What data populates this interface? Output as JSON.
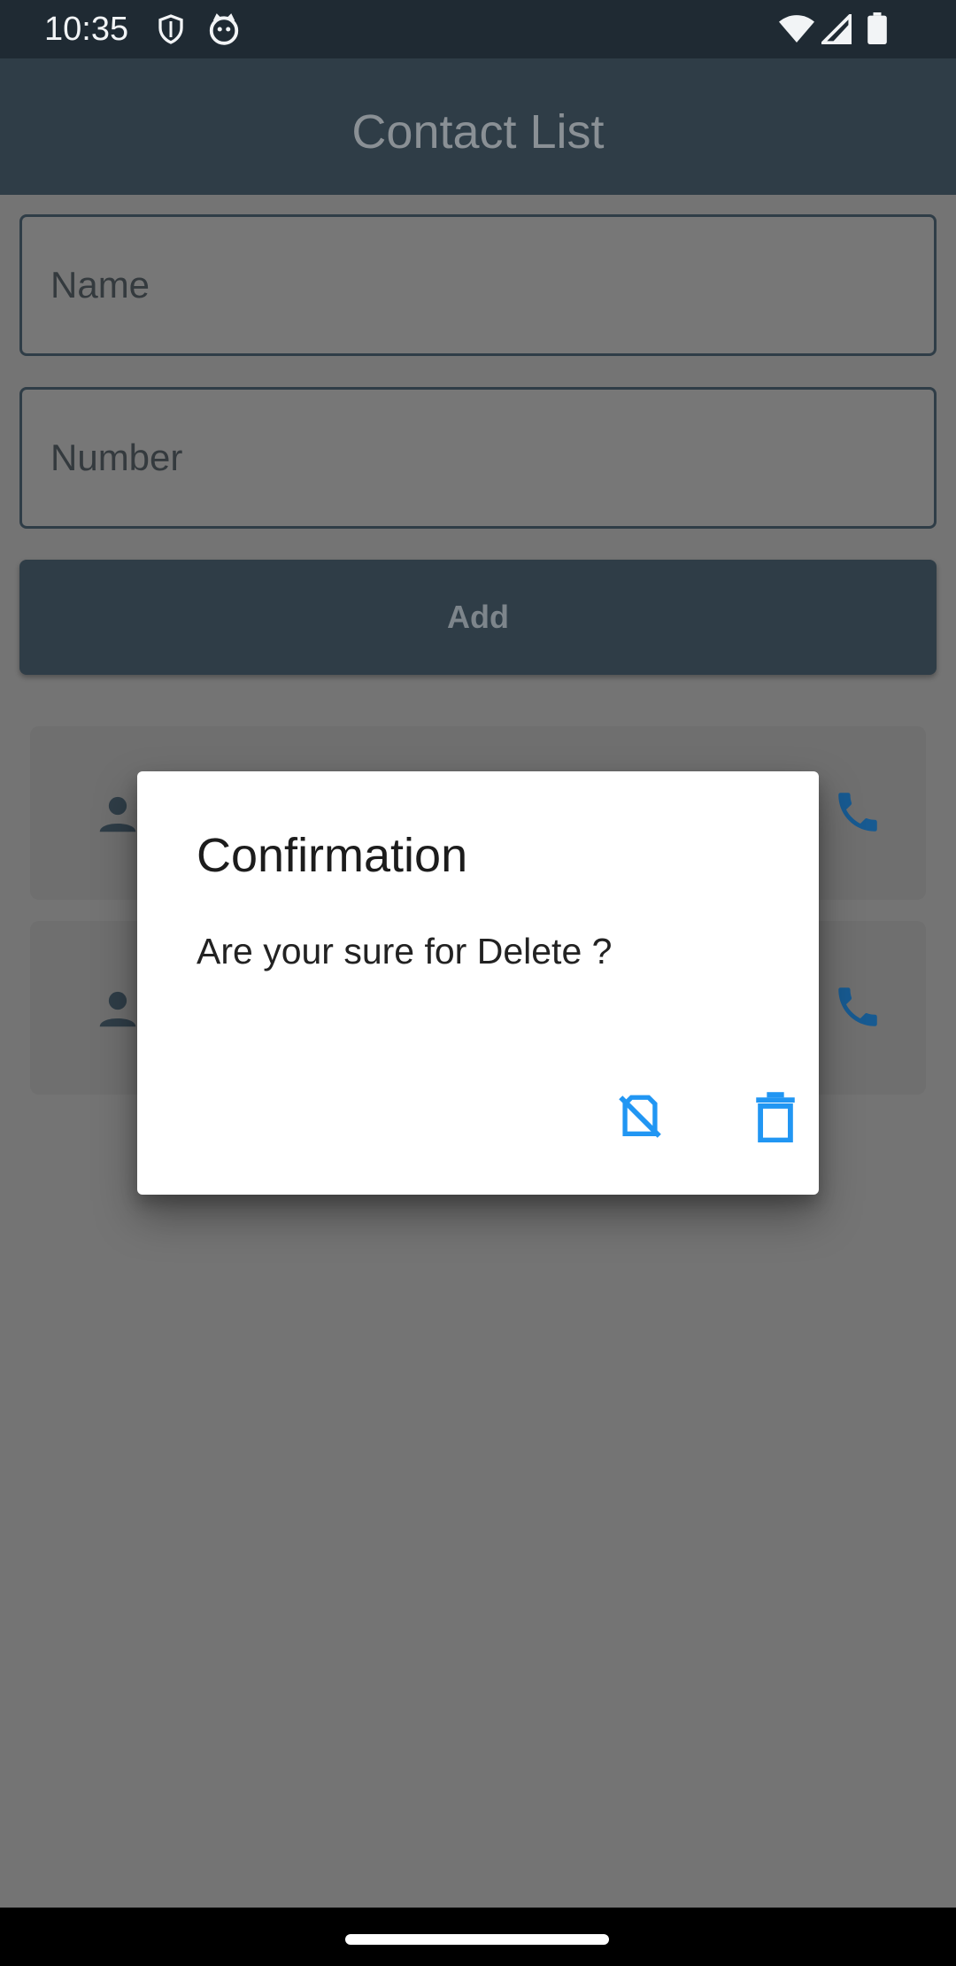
{
  "status_bar": {
    "time": "10:35",
    "icons": [
      "shield-icon",
      "cat-icon",
      "wifi-icon",
      "signal-icon",
      "battery-icon"
    ]
  },
  "app_bar": {
    "title": "Contact List"
  },
  "form": {
    "name_placeholder": "Name",
    "number_placeholder": "Number",
    "add_label": "Add"
  },
  "contacts": {
    "cards": [
      {
        "icon": "person-icon",
        "action_icon": "phone-icon"
      },
      {
        "icon": "person-icon",
        "action_icon": "phone-icon"
      }
    ]
  },
  "dialog": {
    "title": "Confirmation",
    "message": "Are your sure for Delete ?",
    "actions": [
      {
        "icon": "no-sim-icon",
        "meaning": "cancel"
      },
      {
        "icon": "trash-icon",
        "meaning": "delete"
      }
    ]
  },
  "colors": {
    "app_bar": "#2f3d47",
    "scrim_background": "#747474",
    "accent_blue": "#2196f3",
    "phone_icon_blue": "#175a91",
    "dialog_background": "#ffffff"
  }
}
